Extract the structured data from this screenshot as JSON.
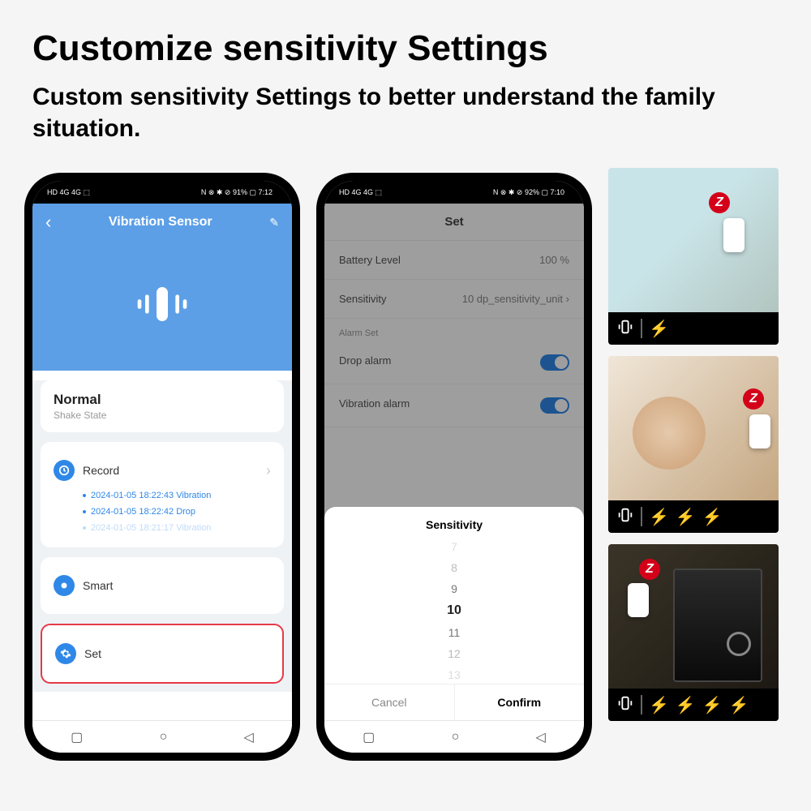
{
  "heading": "Customize sensitivity Settings",
  "subheading": "Custom sensitivity Settings to better understand the family situation.",
  "phone1": {
    "status": {
      "left": "HD 4G 4G ⬚",
      "right": "N ⊗ ✱ ⊘ 91% ▢ 7:12"
    },
    "header": {
      "title": "Vibration Sensor"
    },
    "state": {
      "title": "Normal",
      "subtitle": "Shake State"
    },
    "record": {
      "label": "Record",
      "items": [
        "2024-01-05 18:22:43 Vibration",
        "2024-01-05 18:22:42 Drop",
        "2024-01-05 18:21:17 Vibration"
      ]
    },
    "smart": {
      "label": "Smart"
    },
    "set": {
      "label": "Set"
    }
  },
  "phone2": {
    "status": {
      "left": "HD 4G 4G ⬚",
      "right": "N ⊗ ✱ ⊘ 92% ▢ 7:10"
    },
    "title": "Set",
    "battery": {
      "label": "Battery Level",
      "value": "100 %"
    },
    "sensitivity": {
      "label": "Sensitivity",
      "value": "10 dp_sensitivity_unit"
    },
    "alarmSection": "Alarm Set",
    "dropAlarm": {
      "label": "Drop alarm"
    },
    "vibrationAlarm": {
      "label": "Vibration alarm"
    },
    "picker": {
      "title": "Sensitivity",
      "values": [
        "7",
        "8",
        "9",
        "10",
        "11",
        "12",
        "13"
      ],
      "selected": "10",
      "cancel": "Cancel",
      "confirm": "Confirm"
    }
  },
  "thumbs": {
    "zigbee": "Z",
    "bolts": {
      "t1": 1,
      "t2": 3,
      "t3": 4
    }
  }
}
